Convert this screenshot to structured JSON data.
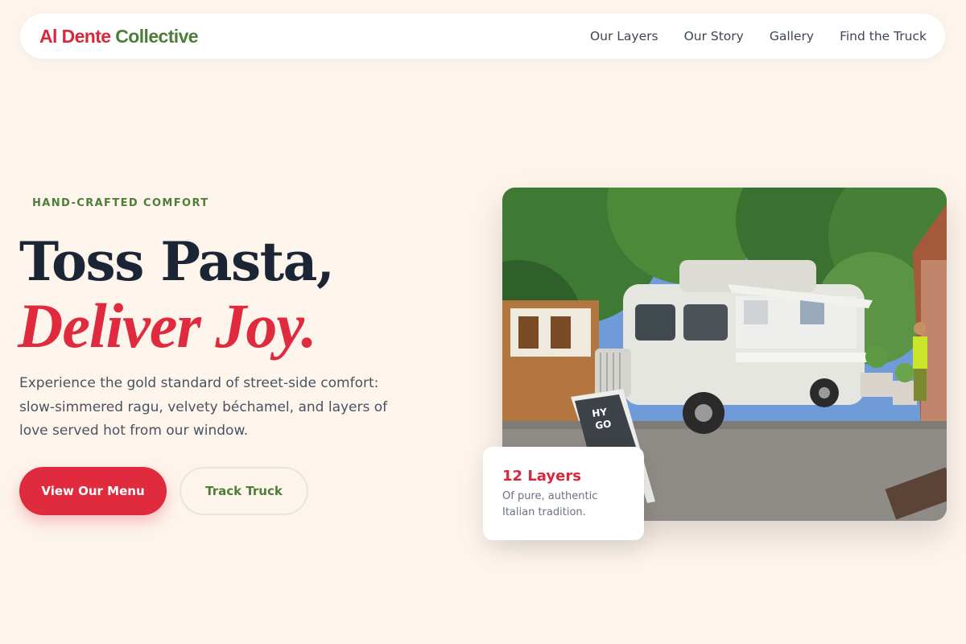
{
  "brand": {
    "name_part1": "Al Dente",
    "name_part2": "Collective"
  },
  "nav": {
    "links": [
      "Our Layers",
      "Our Story",
      "Gallery",
      "Find the Truck"
    ]
  },
  "hero": {
    "eyebrow": "HAND-CRAFTED COMFORT",
    "headline_line1": "Toss Pasta,",
    "headline_line2": "Deliver Joy.",
    "lead": "Experience the gold standard of street-side comfort: slow-simmered ragu, velvety béchamel, and layers of love served hot from our window.",
    "primary_button": "View Our Menu",
    "secondary_button": "Track Truck",
    "photo_icon": "food-truck-photo"
  },
  "stat_card": {
    "title": "12 Layers",
    "subtitle": "Of pure, authentic Italian tradition."
  },
  "colors": {
    "background": "#fdf5ec",
    "accent_red": "#e02a3e",
    "accent_green": "#4e7d3a",
    "heading_dark": "#1c2536"
  }
}
